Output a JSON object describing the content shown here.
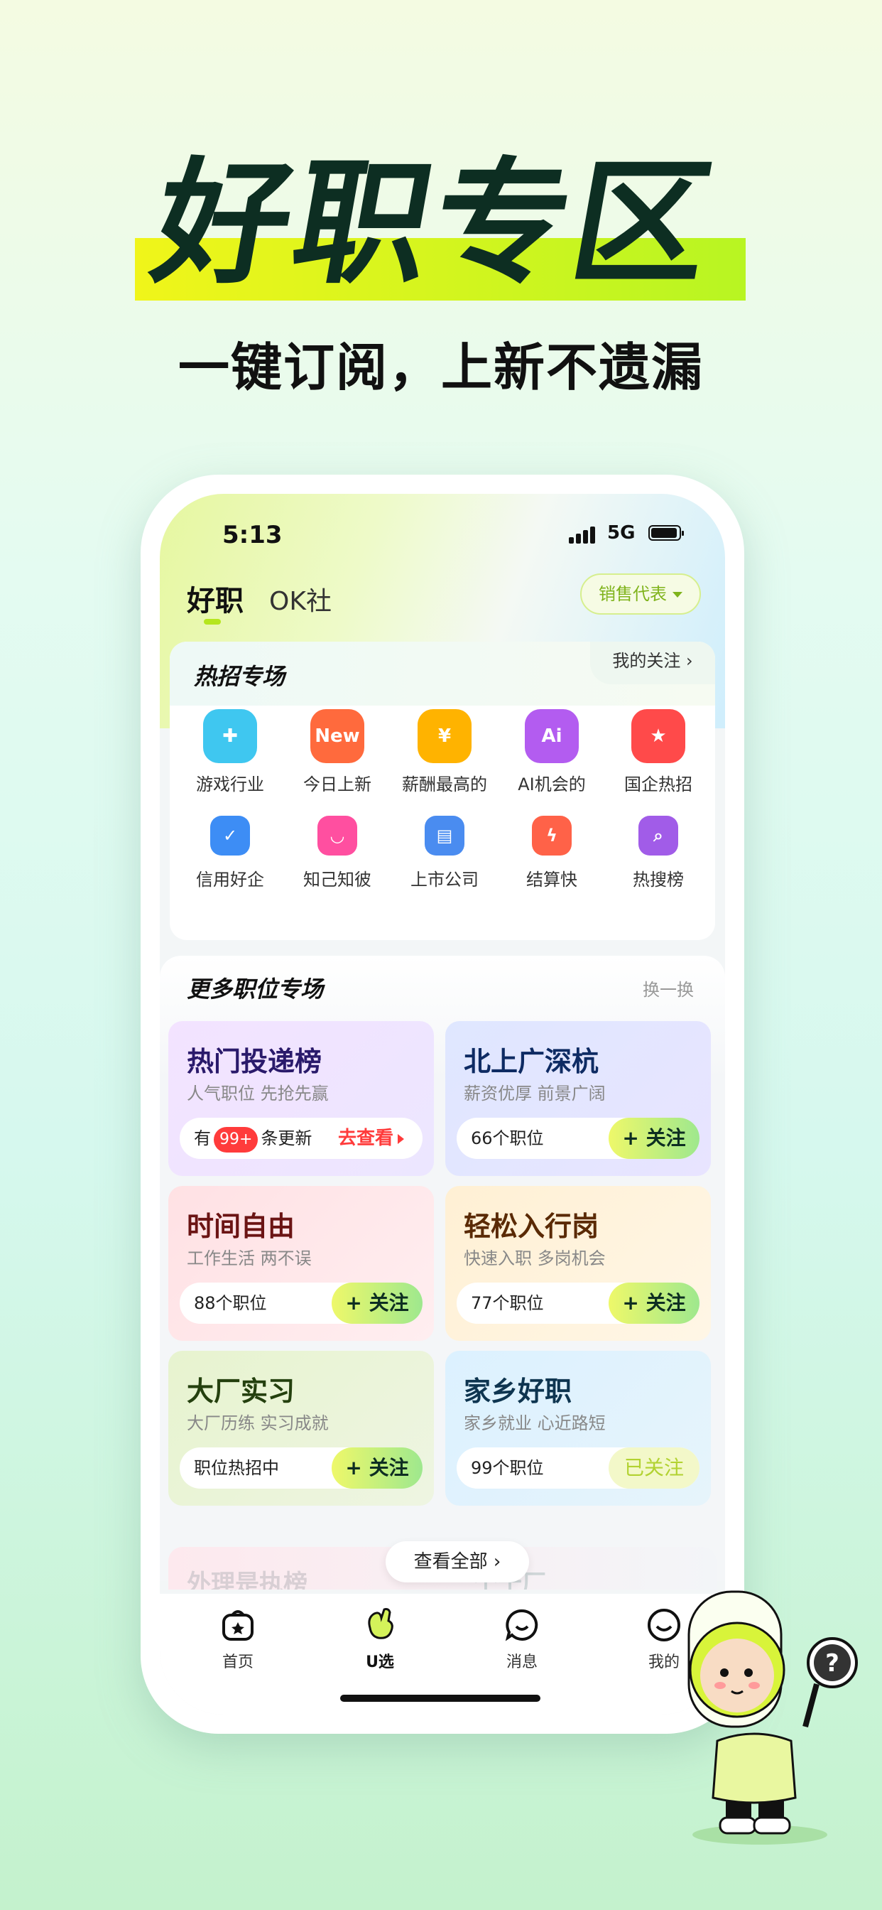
{
  "hero": {
    "title": "好职专区",
    "subtitle": "一键订阅，上新不遗漏"
  },
  "status": {
    "time": "5:13",
    "network": "5G"
  },
  "tabs": {
    "main": "好职",
    "secondary": "OK社"
  },
  "role_selector": {
    "label": "销售代表"
  },
  "hot": {
    "title_pre": "热招",
    "title_post": "专场",
    "follow_link": "我的关注 ›",
    "items": [
      {
        "label": "游戏行业",
        "icon": "gamepad-icon",
        "color": "#3fc7f0",
        "glyph": "✚"
      },
      {
        "label": "今日上新",
        "icon": "new-bubble-icon",
        "color": "#ff6a3d",
        "glyph": "New"
      },
      {
        "label": "薪酬最高的",
        "icon": "yen-coin-icon",
        "color": "#ffb300",
        "glyph": "¥"
      },
      {
        "label": "AI机会的",
        "icon": "ai-icon",
        "color": "#b35cf0",
        "glyph": "Ai"
      },
      {
        "label": "国企热招",
        "icon": "red-flag-icon",
        "color": "#ff4a4a",
        "glyph": "★"
      },
      {
        "label": "信用好企",
        "icon": "shield-check-icon",
        "color": "#3d8df5",
        "glyph": "✓"
      },
      {
        "label": "知己知彼",
        "icon": "heart-smile-icon",
        "color": "#ff4fa0",
        "glyph": "◡"
      },
      {
        "label": "上市公司",
        "icon": "building-icon",
        "color": "#4a8cf0",
        "glyph": "▤"
      },
      {
        "label": "结算快",
        "icon": "alarm-clock-icon",
        "color": "#ff6248",
        "glyph": "ϟ"
      },
      {
        "label": "热搜榜",
        "icon": "search-flame-icon",
        "color": "#a15ce8",
        "glyph": "⌕"
      }
    ]
  },
  "more": {
    "title": "更多职位专场",
    "refresh": "换一换",
    "topics": [
      {
        "title": "热门投递榜",
        "sub": "人气职位 先抢先赢",
        "count_pre": "有",
        "badge": "99+",
        "count_post": "条更新",
        "action": "去查看",
        "title_color": "#2a1a6b",
        "bg": "linear-gradient(135deg,#f3e3ff 0%,#ece6ff 100%)"
      },
      {
        "title": "北上广深杭",
        "sub": "薪资优厚 前景广阔",
        "count": "66个职位",
        "action": "+ 关注",
        "title_color": "#0e2b63",
        "bg": "linear-gradient(135deg,#dfe7ff 0%,#e8e4ff 100%)"
      },
      {
        "title": "时间自由",
        "sub": "工作生活 两不误",
        "count": "88个职位",
        "action": "+ 关注",
        "title_color": "#6b1414",
        "bg": "linear-gradient(135deg,#ffe1e4 0%,#ffeef0 100%)"
      },
      {
        "title": "轻松入行岗",
        "sub": "快速入职 多岗机会",
        "count": "77个职位",
        "action": "+ 关注",
        "title_color": "#5a2a05",
        "bg": "linear-gradient(135deg,#fff0d4 0%,#fff6e6 100%)"
      },
      {
        "title": "大厂实习",
        "sub": "大厂历练 实习成就",
        "count": "职位热招中",
        "action": "+ 关注",
        "title_color": "#24400e",
        "bg": "linear-gradient(135deg,#e7f3cf 0%,#eef5e2 100%)"
      },
      {
        "title": "家乡好职",
        "sub": "家乡就业 心近路短",
        "count": "99个职位",
        "action": "已关注",
        "title_color": "#0e3550",
        "bg": "linear-gradient(135deg,#dcf1ff 0%,#e6f4fb 100%)"
      }
    ],
    "peek_left": "外理是执榜",
    "peek_right": "个十厂",
    "view_all": "查看全部 ›"
  },
  "nav": [
    {
      "label": "首页",
      "icon": "home-bag-icon"
    },
    {
      "label": "U选",
      "icon": "hand-ok-icon"
    },
    {
      "label": "消息",
      "icon": "message-smile-icon"
    },
    {
      "label": "我的",
      "icon": "profile-smile-icon"
    }
  ]
}
